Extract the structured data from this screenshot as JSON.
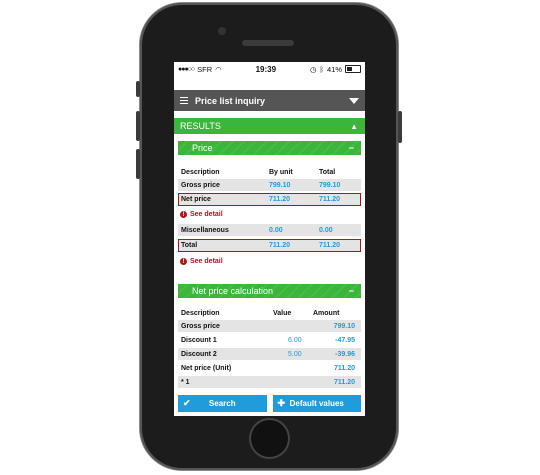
{
  "status": {
    "carrier": "SFR",
    "time": "19:39",
    "battery": "41%"
  },
  "header": {
    "title": "Price list inquiry"
  },
  "results": {
    "label": "RESULTS"
  },
  "price": {
    "title": "Price",
    "columns": [
      "Description",
      "By unit",
      "Total"
    ],
    "rows": [
      {
        "desc": "Gross price",
        "unit": "799.10",
        "total": "799.10"
      },
      {
        "desc": "Net price",
        "unit": "711.20",
        "total": "711.20"
      },
      {
        "desc": "Miscellaneous",
        "unit": "0.00",
        "total": "0.00"
      },
      {
        "desc": "Total",
        "unit": "711.20",
        "total": "711.20"
      }
    ],
    "see_detail": "See detail"
  },
  "net": {
    "title": "Net price calculation",
    "columns": [
      "Description",
      "Value",
      "Amount"
    ],
    "rows": [
      {
        "desc": "Gross price",
        "value": "",
        "amount": "799.10"
      },
      {
        "desc": "Discount 1",
        "value": "6.00",
        "amount": "-47.95"
      },
      {
        "desc": "Discount 2",
        "value": "5.00",
        "amount": "-39.96"
      },
      {
        "desc": "Net price (Unit)",
        "value": "",
        "amount": "711.20"
      },
      {
        "desc": "* 1",
        "value": "",
        "amount": "711.20"
      }
    ]
  },
  "buttons": {
    "search": "Search",
    "default": "Default values"
  },
  "colors": {
    "green": "#3bb53a",
    "blue": "#1f9cdc",
    "red": "#b0141b",
    "header": "#555555"
  }
}
